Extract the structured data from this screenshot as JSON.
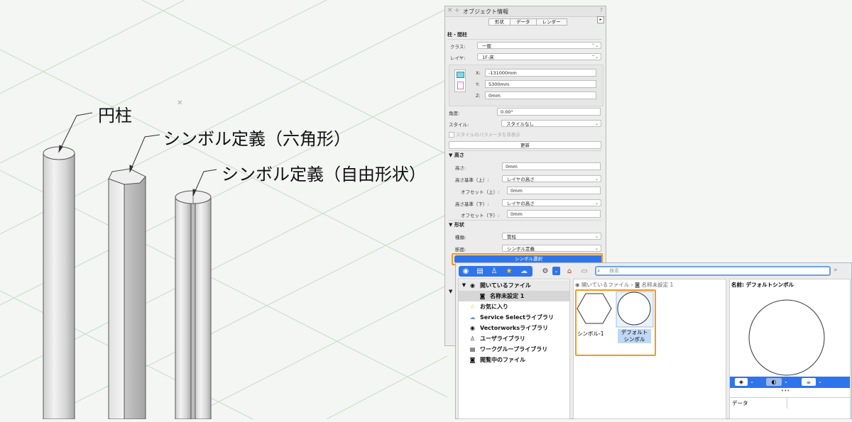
{
  "callouts": {
    "cylinder": "円柱",
    "hexagon": "シンボル定義（六角形）",
    "freeform": "シンボル定義（自由形状）"
  },
  "oip": {
    "title": "オブジェクト情報",
    "tabs": [
      "形状",
      "データ",
      "レンダー"
    ],
    "object_type": "柱・間柱",
    "class_label": "クラス:",
    "class_value": "一般",
    "layer_label": "レイヤ:",
    "layer_value": "1F-床",
    "x_label": "X:",
    "x_value": "-131000mm",
    "y_label": "Y:",
    "y_value": "5300mm",
    "z_label": "Z:",
    "z_value": "0mm",
    "angle_label": "角度:",
    "angle_value": "0.00°",
    "style_label": "スタイル:",
    "style_value": "スタイルなし",
    "style_params_label": "スタイルのパラメータを非表示",
    "update_button": "更新",
    "height_section": "高さ",
    "height_label": "高さ:",
    "height_value": "0mm",
    "top_ref_label": "高さ基準（上）:",
    "top_ref_value": "レイヤの高さ",
    "offset_top_label": "オフセット（上）:",
    "offset_top_value": "0mm",
    "bottom_ref_label": "高さ基準（下）:",
    "bottom_ref_value": "レイヤの高さ",
    "offset_bottom_label": "オフセット（下）:",
    "offset_bottom_value": "0mm",
    "shape_section": "形状",
    "kind_label": "種類:",
    "kind_value": "管柱",
    "section_label": "断面:",
    "section_value": "シンボル定義",
    "symbol_select_button": "シンボル選択"
  },
  "rm": {
    "search_placeholder": "検索",
    "tree": [
      {
        "label": "開いているファイル",
        "icon": "vectorworks-icon"
      },
      {
        "label": "名称未設定 1",
        "icon": "file-icon"
      },
      {
        "label": "お気に入り",
        "icon": "star-icon"
      },
      {
        "label": "Service Selectライブラリ",
        "icon": "cloud-icon"
      },
      {
        "label": "Vectorworksライブラリ",
        "icon": "vectorworks-icon"
      },
      {
        "label": "ユーザライブラリ",
        "icon": "user-library-icon"
      },
      {
        "label": "ワークグループライブラリ",
        "icon": "workgroup-library-icon"
      },
      {
        "label": "閲覧中のファイル",
        "icon": "file-icon"
      }
    ],
    "breadcrumb_root": "開いているファイル",
    "breadcrumb_sep": "›",
    "breadcrumb_file": "名称未設定 1",
    "symbol1_label": "シンボル-1",
    "symbol2_label": "デフォルト\nシンボル",
    "preview_name_label": "名前:",
    "preview_name_value": "デフォルトシンボル",
    "data_label": "データ"
  },
  "colors": {
    "accent_blue": "#2f74ea",
    "highlight_orange": "#f39a1d",
    "selection_blue": "#bfd8f7"
  }
}
